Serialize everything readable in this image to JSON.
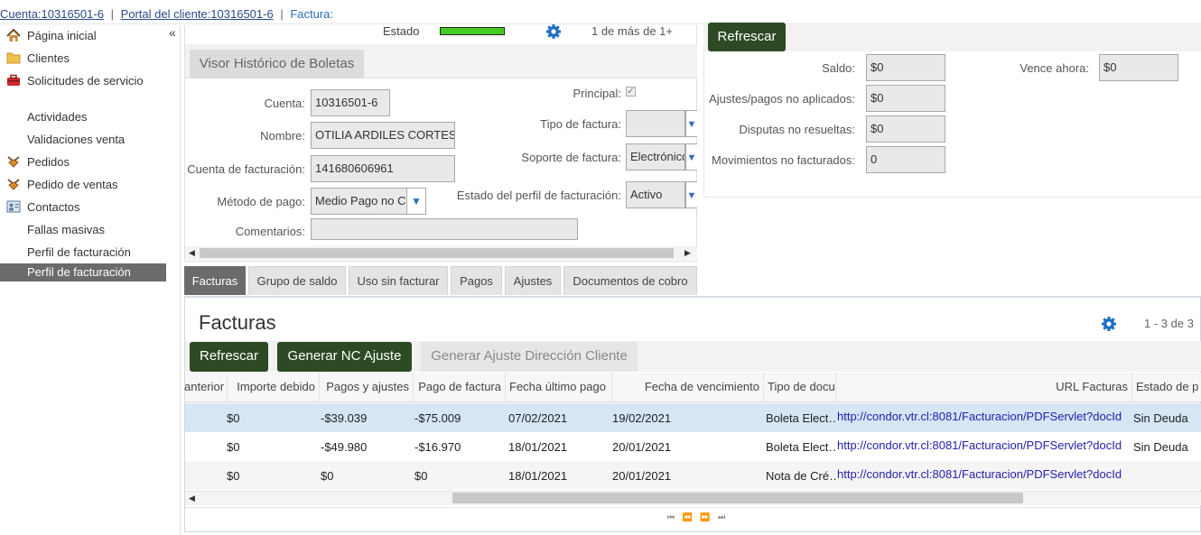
{
  "breadcrumb": {
    "account": "Cuenta:10316501-6",
    "portal": "Portal del cliente:10316501-6",
    "current": "Factura:",
    "separator": "|"
  },
  "sidebar": {
    "collapse_glyph": "«",
    "items": [
      {
        "label": "Página inicial",
        "icon": "home-icon"
      },
      {
        "label": "Clientes",
        "icon": "folder-icon"
      },
      {
        "label": "Solicitudes de servicio",
        "icon": "toolbox-icon"
      },
      {
        "label": "Actividades",
        "icon": ""
      },
      {
        "label": "Validaciones venta",
        "icon": ""
      },
      {
        "label": "Pedidos",
        "icon": "order-icon"
      },
      {
        "label": "Pedido de ventas",
        "icon": "order-icon"
      },
      {
        "label": "Contactos",
        "icon": "contacts-icon"
      },
      {
        "label": "Fallas masivas",
        "icon": ""
      },
      {
        "label": "Perfil de facturación",
        "icon": ""
      },
      {
        "label": "Perfil de facturación",
        "icon": ""
      }
    ]
  },
  "status_bar": {
    "estado_label": "Estado",
    "estado_color": "#44cc22",
    "paging": "1 de más de 1+"
  },
  "form": {
    "section_button": "Visor Histórico de Boletas",
    "cuenta_label": "Cuenta:",
    "cuenta_value": "10316501-6",
    "nombre_label": "Nombre:",
    "nombre_value": "OTILIA ARDILES CORTES",
    "cuenta_fact_label": "Cuenta de facturación:",
    "cuenta_fact_value": "141680606961",
    "metodo_label": "Método de pago:",
    "metodo_value": "Medio Pago no C",
    "comentarios_label": "Comentarios:",
    "principal_label": "Principal:",
    "tipo_factura_label": "Tipo de factura:",
    "soporte_label": "Soporte de factura:",
    "soporte_value": "Electrónico",
    "estado_perfil_label": "Estado del perfil de facturación:",
    "estado_perfil_value": "Activo"
  },
  "balance": {
    "refresh_label": "Refrescar",
    "saldo_label": "Saldo:",
    "saldo_value": "$0",
    "ajustes_label": "Ajustes/pagos no aplicados:",
    "ajustes_value": "$0",
    "disputas_label": "Disputas no resueltas:",
    "disputas_value": "$0",
    "movimientos_label": "Movimientos no facturados:",
    "movimientos_value": "0",
    "vence_label": "Vence ahora:",
    "vence_value": "$0"
  },
  "tabs": [
    "Facturas",
    "Grupo de saldo",
    "Uso sin facturar",
    "Pagos",
    "Ajustes",
    "Documentos de cobro"
  ],
  "invoices": {
    "title": "Facturas",
    "paging": "1 - 3 de 3",
    "btn_refresh": "Refrescar",
    "btn_generate_nc": "Generar NC Ajuste",
    "btn_generate_address": "Generar Ajuste Dirección Cliente",
    "columns": [
      "anterior",
      "Importe debido",
      "Pagos y ajustes",
      "Pago de factura",
      "Fecha último pago",
      "Fecha de vencimiento",
      "Tipo de docu",
      "URL Facturas",
      "Estado de p"
    ],
    "rows": [
      {
        "anterior": "",
        "importe": "$0",
        "pagos": "-$39.039",
        "pago_factura": "-$75.009",
        "fecha_ultimo": "07/02/2021",
        "fecha_venc": "19/02/2021",
        "tipo": "Boleta Elect…",
        "url": "http://condor.vtr.cl:8081/Facturacion/PDFServlet?docId",
        "estado": "Sin Deuda"
      },
      {
        "anterior": "",
        "importe": "$0",
        "pagos": "-$49.980",
        "pago_factura": "-$16.970",
        "fecha_ultimo": "18/01/2021",
        "fecha_venc": "20/01/2021",
        "tipo": "Boleta Elect…",
        "url": "http://condor.vtr.cl:8081/Facturacion/PDFServlet?docId",
        "estado": "Sin Deuda"
      },
      {
        "anterior": "",
        "importe": "$0",
        "pagos": "$0",
        "pago_factura": "$0",
        "fecha_ultimo": "18/01/2021",
        "fecha_venc": "20/01/2021",
        "tipo": "Nota de Cré…",
        "url": "http://condor.vtr.cl:8081/Facturacion/PDFServlet?docId",
        "estado": ""
      }
    ]
  },
  "colors": {
    "accent_green": "#2d4a24",
    "selected_row": "#d6e6f5",
    "active_tab": "#6b6b6b",
    "link": "#2222aa"
  }
}
